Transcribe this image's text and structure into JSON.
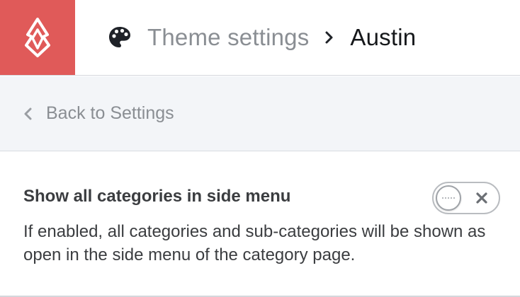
{
  "app": {
    "brand_color": "#e05a59",
    "logo_icon": "lightspeed-flame-icon"
  },
  "header": {
    "icon": "palette-icon",
    "breadcrumb_parent": "Theme settings",
    "breadcrumb_separator_icon": "chevron-right-icon",
    "breadcrumb_current": "Austin"
  },
  "back": {
    "icon": "chevron-left-icon",
    "label": "Back to Settings"
  },
  "setting": {
    "title": "Show all categories in side menu",
    "description": "If enabled, all categories and sub-categories will be shown as open in the side menu of the category page.",
    "toggle": {
      "enabled": false,
      "off_icon": "close-icon"
    }
  }
}
